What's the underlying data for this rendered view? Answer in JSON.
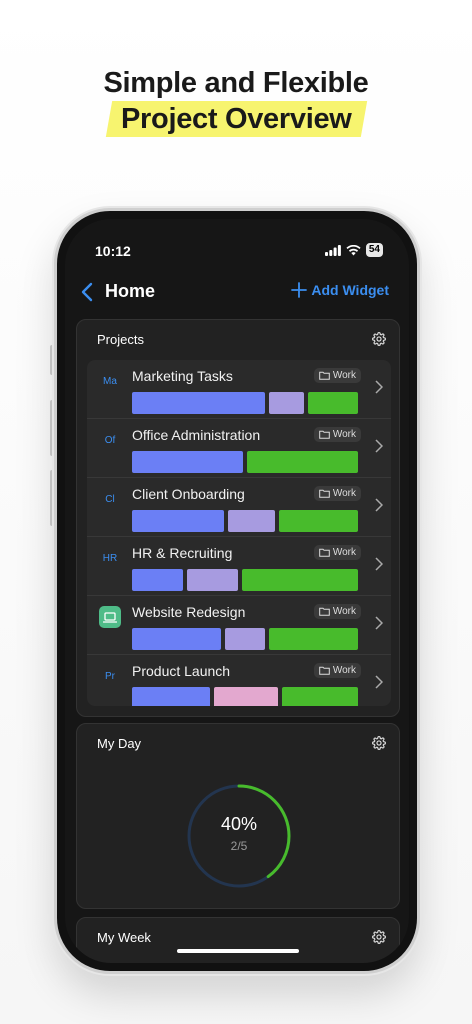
{
  "headline": {
    "line1": "Simple and Flexible",
    "line2": "Project Overview",
    "highlight_color": "#f7f46f"
  },
  "status_bar": {
    "time": "10:12",
    "battery": "54"
  },
  "nav": {
    "title": "Home",
    "add_widget": "Add Widget",
    "accent": "#3b8ef0"
  },
  "projects_widget": {
    "title": "Projects",
    "items": [
      {
        "abbr": "Ma",
        "name": "Marketing Tasks",
        "tag": "Work",
        "segments": [
          {
            "color": "#6b7ff5",
            "share": 0.56
          },
          {
            "color": "#a79be0",
            "share": 0.15
          },
          {
            "color": "#48bb2c",
            "share": 0.21
          }
        ]
      },
      {
        "abbr": "Of",
        "name": "Office Administration",
        "tag": "Work",
        "segments": [
          {
            "color": "#6b7ff5",
            "share": 0.49
          },
          {
            "color": "#48bb2c",
            "share": 0.49
          }
        ]
      },
      {
        "abbr": "Cl",
        "name": "Client Onboarding",
        "tag": "Work",
        "segments": [
          {
            "color": "#6b7ff5",
            "share": 0.41
          },
          {
            "color": "#a79be0",
            "share": 0.21
          },
          {
            "color": "#48bb2c",
            "share": 0.35
          }
        ]
      },
      {
        "abbr": "HR",
        "name": "HR & Recruiting",
        "tag": "Work",
        "segments": [
          {
            "color": "#6b7ff5",
            "share": 0.23
          },
          {
            "color": "#a79be0",
            "share": 0.23
          },
          {
            "color": "#48bb2c",
            "share": 0.52
          }
        ]
      },
      {
        "abbr": "",
        "icon": "laptop-icon",
        "name": "Website Redesign",
        "tag": "Work",
        "segments": [
          {
            "color": "#6b7ff5",
            "share": 0.4
          },
          {
            "color": "#a79be0",
            "share": 0.18
          },
          {
            "color": "#48bb2c",
            "share": 0.4
          }
        ]
      },
      {
        "abbr": "Pr",
        "name": "Product Launch",
        "tag": "Work",
        "segments": [
          {
            "color": "#6b7ff5",
            "share": 0.35
          },
          {
            "color": "#e3a8cf",
            "share": 0.29
          },
          {
            "color": "#48bb2c",
            "share": 0.34
          }
        ]
      }
    ]
  },
  "my_day_widget": {
    "title": "My Day",
    "percent": "40%",
    "fraction": "2/5",
    "progress": 0.4,
    "ring_color": "#48bb2c"
  },
  "my_week_widget": {
    "title": "My Week"
  }
}
